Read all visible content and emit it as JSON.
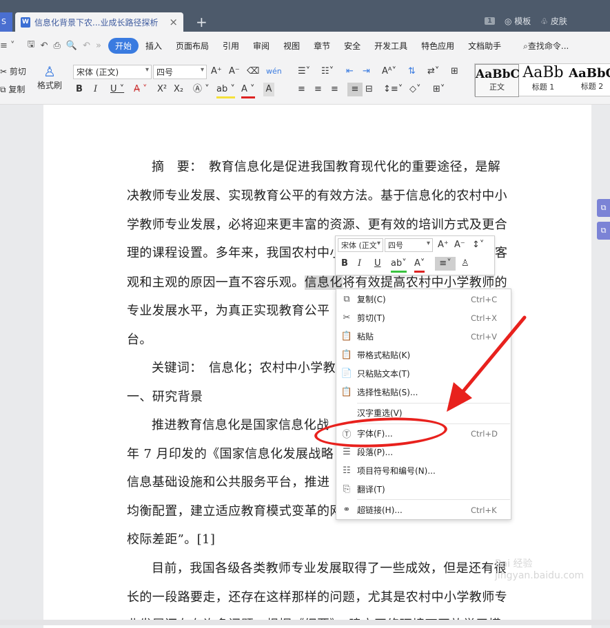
{
  "tab": {
    "app_icon": "S",
    "doc_icon": "W",
    "title": "信息化背景下农...业成长路径探析",
    "close": "×",
    "new": "+"
  },
  "titlebar_right": {
    "count": "1",
    "template": "模板",
    "skin": "皮肤"
  },
  "menu": {
    "items": [
      "开始",
      "插入",
      "页面布局",
      "引用",
      "审阅",
      "视图",
      "章节",
      "安全",
      "开发工具",
      "特色应用",
      "文档助手"
    ],
    "active": "开始",
    "search": "查找命令..."
  },
  "toolbar": {
    "cut": "剪切",
    "copy": "复制",
    "format_painter": "格式刷",
    "font_name": "宋体 (正文)",
    "font_size": "四号",
    "styles": [
      {
        "sample": "AaBbC",
        "label": "正文"
      },
      {
        "sample": "AaBb",
        "label": "标题 1"
      },
      {
        "sample": "AaBbC",
        "label": "标题 2"
      }
    ]
  },
  "document": {
    "lines": [
      "摘　要：　教育信息化是促进我国教育现代化的重要途径，是解",
      "决教师专业发展、实现教育公平的有效方法。基于信息化的农村中小",
      "学教师专业发展，必将迎来更丰富的资源、更有效的培训方式及更合",
      "理的课程设置。多年来，我国农村中小",
      "观和主观的原因一直不容乐观。",
      "信息化",
      "将有效提高农村中小学教师的",
      "专业发展水平，为真正实现教育公平",
      "台。",
      "关键词：　信息化；农村中小学教",
      "一、研究背景",
      "推进教育信息化是国家信息化战",
      "年 7 月印发的《国家信息化发展战略",
      "信息基础设施和公共服务平台，推进",
      "均衡配置，建立适应教育模式变革的网",
      "校际差距”。[1]",
      "目前，我国各级各类教师专业发展取得了一些成效，但是还有很",
      "长的一段路要走，还存在这样那样的问题，尤其是农村中小学教师专",
      "业发展还存在许多问题。根据《纲要》，建立网络环境下开放学习模"
    ],
    "tail_right": "客"
  },
  "mini_toolbar": {
    "font_name": "宋体 (正文",
    "font_size": "四号"
  },
  "context_menu": [
    {
      "label": "复制(C)",
      "shortcut": "Ctrl+C",
      "icon": "copy-icon"
    },
    {
      "label": "剪切(T)",
      "shortcut": "Ctrl+X",
      "icon": "scissors-icon"
    },
    {
      "label": "粘贴",
      "shortcut": "Ctrl+V",
      "icon": "paste-icon"
    },
    {
      "label": "带格式粘贴(K)",
      "shortcut": "",
      "icon": "paste-format-icon"
    },
    {
      "label": "只粘贴文本(T)",
      "shortcut": "",
      "icon": "paste-text-icon"
    },
    {
      "label": "选择性粘贴(S)...",
      "shortcut": "",
      "icon": "paste-special-icon"
    },
    {
      "label": "汉字重选(V)",
      "shortcut": "",
      "icon": ""
    },
    {
      "label": "字体(F)...",
      "shortcut": "Ctrl+D",
      "icon": "font-icon"
    },
    {
      "label": "段落(P)...",
      "shortcut": "",
      "icon": "paragraph-icon"
    },
    {
      "label": "项目符号和编号(N)...",
      "shortcut": "",
      "icon": "list-icon"
    },
    {
      "label": "翻译(T)",
      "shortcut": "",
      "icon": "translate-icon"
    },
    {
      "label": "超链接(H)...",
      "shortcut": "Ctrl+K",
      "icon": "link-icon"
    }
  ],
  "watermark": "Bai 经验 jingyan.baidu.com",
  "annotation_color": "#e8211d"
}
